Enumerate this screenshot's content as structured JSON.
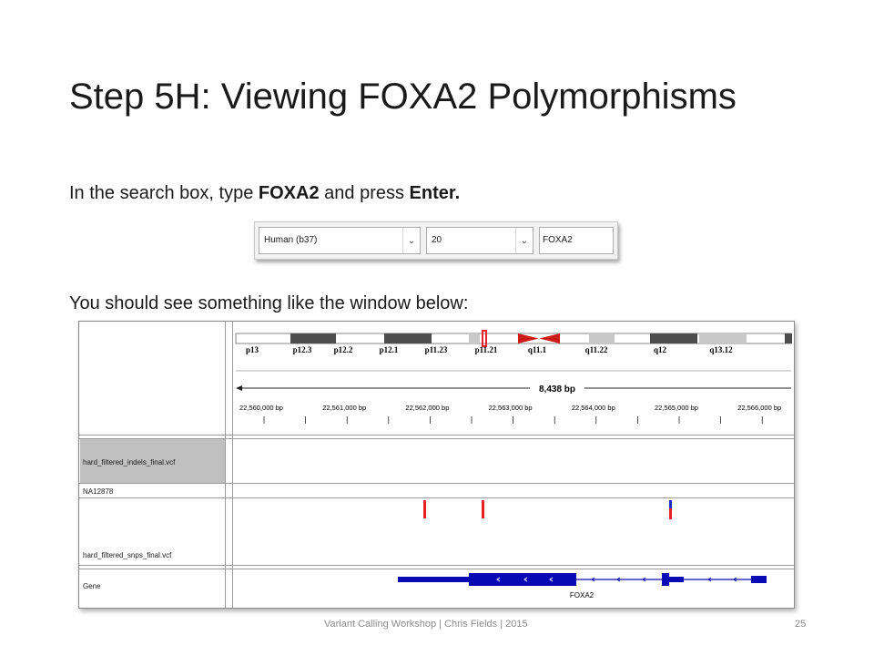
{
  "slide": {
    "title": "Step 5H: Viewing FOXA2 Polymorphisms",
    "instruction": {
      "part1": "In the search box, type ",
      "gene": "FOXA2",
      "part2": " and press ",
      "key": "Enter."
    },
    "caption": "You should see something like the window below:",
    "footer": "Variant Calling Workshop | Chris Fields | 2015",
    "page_number": "25"
  },
  "toolbar": {
    "genome": "Human (b37)",
    "chromosome": "20",
    "locus": "FOXA2"
  },
  "igv": {
    "cytobands": [
      "p13",
      "p12.3",
      "p12.2",
      "p12.1",
      "p11.23",
      "p11.21",
      "q11.1",
      "q11.22",
      "q12",
      "q13.12"
    ],
    "ruler_span": "8,438 bp",
    "ruler_ticks": [
      "22,560,000 bp",
      "22,561,000 bp",
      "22,562,000 bp",
      "22,563,000 bp",
      "22,564,000 bp",
      "22,565,000 bp",
      "22,566,000 bp"
    ],
    "tracks": {
      "indels": "hard_filtered_indels_final.vcf",
      "sample": "NA12878",
      "snps": "hard_filtered_snps_final.vcf",
      "gene": "Gene"
    },
    "gene_name": "FOXA2",
    "colors": {
      "variant": "#e8202a",
      "het_top": "#1a2bcc",
      "gene": "#0a0ab4",
      "centromere": "#cc1b1b"
    }
  }
}
